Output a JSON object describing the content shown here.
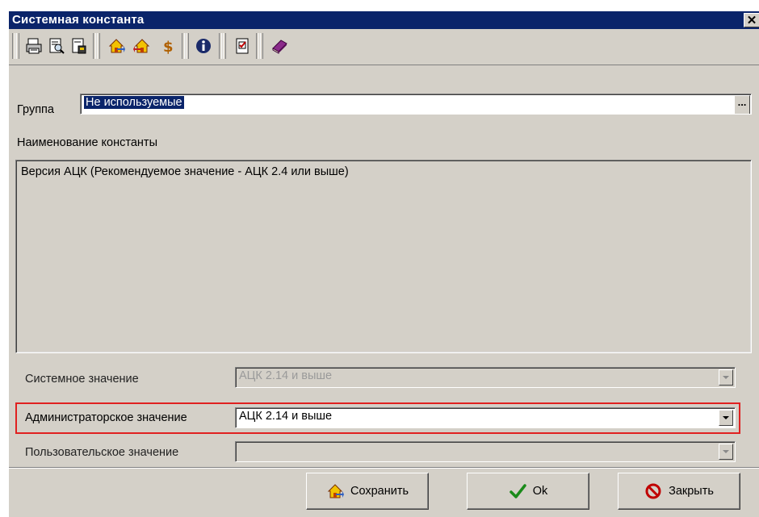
{
  "window": {
    "title": "Системная константа",
    "close_glyph": "✕"
  },
  "toolbar": {
    "buttons": [
      {
        "name": "print-icon"
      },
      {
        "name": "print-preview-icon"
      },
      {
        "name": "export-icon"
      },
      {
        "name": "home-forward-icon"
      },
      {
        "name": "home-back-icon"
      },
      {
        "name": "dollar-icon"
      },
      {
        "name": "info-icon"
      },
      {
        "name": "checklist-icon"
      },
      {
        "name": "book-icon"
      }
    ]
  },
  "group": {
    "label": "Группа",
    "value": "Не используемые",
    "browse_label": "..."
  },
  "constant": {
    "label": "Наименование константы",
    "text": "Версия АЦК (Рекомендуемое значение - АЦК 2.4 или выше)"
  },
  "system_value": {
    "label": "Системное значение",
    "value": "АЦК 2.14 и выше"
  },
  "admin_value": {
    "label": "Администраторское значение",
    "value": "АЦК 2.14 и выше"
  },
  "user_value": {
    "label": "Пользовательское значение",
    "value": ""
  },
  "buttons": {
    "save": "Сохранить",
    "ok": "Ok",
    "close": "Закрыть"
  },
  "colors": {
    "title_bar": "#0a246a",
    "highlight_border": "#e02020",
    "face": "#d4d0c8"
  }
}
